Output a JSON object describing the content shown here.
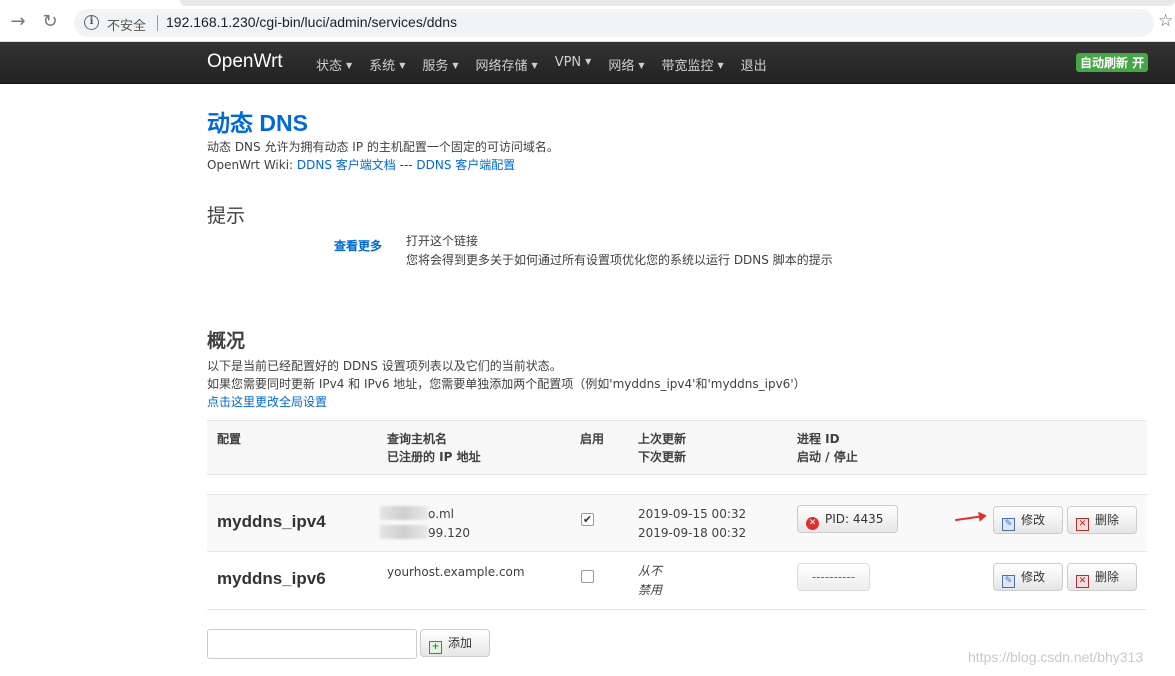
{
  "browser": {
    "security_label": "不安全",
    "url": "192.168.1.230/cgi-bin/luci/admin/services/ddns"
  },
  "navbar": {
    "brand": "OpenWrt",
    "menu": [
      {
        "label": "状态"
      },
      {
        "label": "系统"
      },
      {
        "label": "服务"
      },
      {
        "label": "网络存储"
      },
      {
        "label": "VPN"
      },
      {
        "label": "网络"
      },
      {
        "label": "带宽监控"
      },
      {
        "label": "退出"
      }
    ],
    "autorefresh": "自动刷新 开"
  },
  "page": {
    "title": "动态 DNS",
    "description": "动态 DNS 允许为拥有动态 IP 的主机配置一个固定的可访问域名。",
    "wiki_prefix": "OpenWrt Wiki: ",
    "wiki_link1": "DDNS 客户端文档",
    "wiki_sep": " --- ",
    "wiki_link2": "DDNS 客户端配置"
  },
  "hints": {
    "heading": "提示",
    "link": "查看更多",
    "line1": "打开这个链接",
    "line2": "您将会得到更多关于如何通过所有设置项优化您的系统以运行 DDNS 脚本的提示"
  },
  "overview": {
    "heading": "概况",
    "line1": "以下是当前已经配置好的 DDNS 设置项列表以及它们的当前状态。",
    "line2": "如果您需要同时更新 IPv4 和 IPv6 地址，您需要单独添加两个配置项（例如'myddns_ipv4'和'myddns_ipv6'）",
    "global_link": "点击这里更改全局设置"
  },
  "table": {
    "headers": {
      "config": "配置",
      "host_a": "查询主机名",
      "host_b": "已注册的 IP 地址",
      "enabled": "启用",
      "update_a": "上次更新",
      "update_b": "下次更新",
      "pid_a": "进程 ID",
      "pid_b": "启动 / 停止"
    },
    "rows": [
      {
        "name": "myddns_ipv4",
        "host": "o.ml",
        "ip": "99.120",
        "enabled": true,
        "last_update": "2019-09-15 00:32",
        "next_update": "2019-09-18 00:32",
        "pid": "PID: 4435",
        "edit": "修改",
        "delete": "删除"
      },
      {
        "name": "myddns_ipv6",
        "host": "yourhost.example.com",
        "ip": "",
        "enabled": false,
        "last_update": "从不",
        "next_update": "禁用",
        "pid": "----------",
        "edit": "修改",
        "delete": "删除"
      }
    ]
  },
  "add": {
    "input_value": "",
    "button": "添加"
  },
  "watermark": "https://blog.csdn.net/bhy313"
}
